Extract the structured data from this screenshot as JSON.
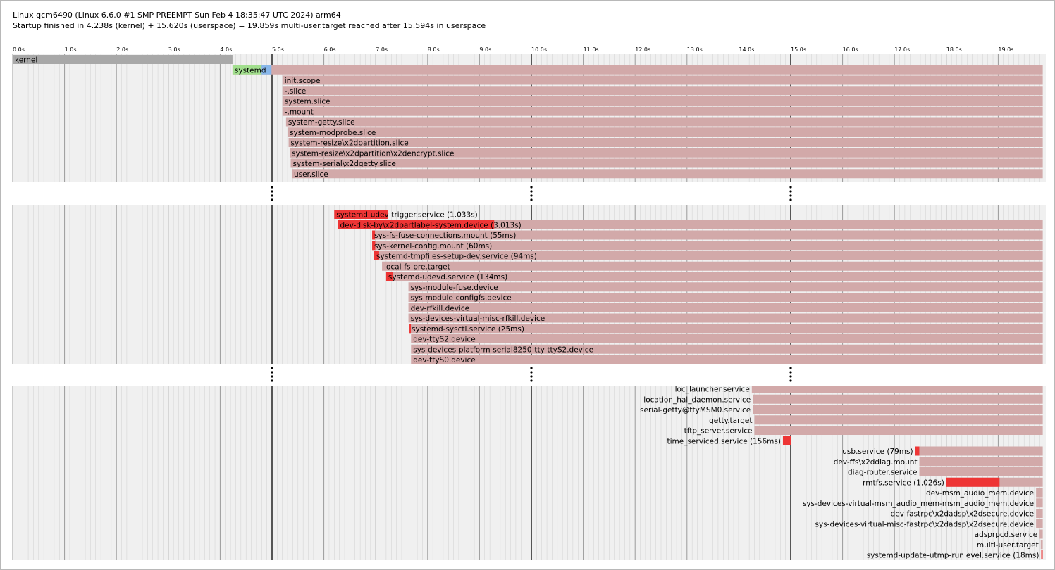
{
  "header": {
    "line1": "Linux qcm6490 (Linux 6.6.0 #1 SMP PREEMPT Sun Feb 4 18:35:47 UTC 2024) arm64",
    "line2": "Startup finished in 4.238s (kernel) + 15.620s (userspace) = 19.859s multi-user.target reached after 15.594s in userspace"
  },
  "colors": {
    "kernel": "#a8a8a8",
    "systemd": "#a2df8e",
    "systemd_tail": "#88b7ea",
    "active": "#d2a9a9",
    "activating": "#ee3535",
    "grid_bg": "#f0f0f0",
    "grid_minor": "#d0d0d0",
    "grid_major": "#505050"
  },
  "chart_data": {
    "type": "gantt",
    "x_unit": "s",
    "xlim": [
      0,
      19.9
    ],
    "ticks": [
      "0.0s",
      "1.0s",
      "2.0s",
      "3.0s",
      "4.0s",
      "5.0s",
      "6.0s",
      "7.0s",
      "8.0s",
      "9.0s",
      "10.0s",
      "11.0s",
      "12.0s",
      "13.0s",
      "14.0s",
      "15.0s",
      "16.0s",
      "17.0s",
      "18.0s",
      "19.0s"
    ],
    "sections": [
      {
        "rows": [
          {
            "label": "kernel",
            "start": 0.0,
            "end": 4.238,
            "kind": "kernel",
            "label_side": "inside"
          },
          {
            "label": "systemd",
            "start": 4.238,
            "end": 19.859,
            "kind": "systemd",
            "activating_end": 4.99,
            "label_side": "left"
          },
          {
            "label": "init.scope",
            "start": 5.2,
            "end": 19.859,
            "kind": "unit",
            "label_side": "inside"
          },
          {
            "label": "-.slice",
            "start": 5.2,
            "end": 19.859,
            "kind": "unit",
            "label_side": "inside"
          },
          {
            "label": "system.slice",
            "start": 5.2,
            "end": 19.859,
            "kind": "unit",
            "label_side": "inside"
          },
          {
            "label": "-.mount",
            "start": 5.2,
            "end": 19.859,
            "kind": "unit",
            "label_side": "inside"
          },
          {
            "label": "system-getty.slice",
            "start": 5.27,
            "end": 19.859,
            "kind": "unit",
            "label_side": "inside"
          },
          {
            "label": "system-modprobe.slice",
            "start": 5.3,
            "end": 19.859,
            "kind": "unit",
            "label_side": "inside"
          },
          {
            "label": "system-resize\\x2dpartition.slice",
            "start": 5.32,
            "end": 19.859,
            "kind": "unit",
            "label_side": "inside"
          },
          {
            "label": "system-resize\\x2dpartition\\x2dencrypt.slice",
            "start": 5.34,
            "end": 19.859,
            "kind": "unit",
            "label_side": "inside"
          },
          {
            "label": "system-serial\\x2dgetty.slice",
            "start": 5.36,
            "end": 19.859,
            "kind": "unit",
            "label_side": "inside"
          },
          {
            "label": "user.slice",
            "start": 5.38,
            "end": 19.859,
            "kind": "unit",
            "label_side": "inside"
          }
        ]
      },
      {
        "rows": [
          {
            "label": "systemd-udev-trigger.service (1.033s)",
            "start": 6.2,
            "end": 7.233,
            "kind": "unit",
            "activating_end": 7.233,
            "label_side": "inside"
          },
          {
            "label": "dev-disk-by\\x2dpartlabel-system.device (3.013s)",
            "start": 6.27,
            "end": 19.859,
            "kind": "unit",
            "activating_end": 9.283,
            "label_side": "inside"
          },
          {
            "label": "sys-fs-fuse-connections.mount (55ms)",
            "start": 6.93,
            "end": 19.859,
            "kind": "unit",
            "activating_end": 6.985,
            "label_side": "inside"
          },
          {
            "label": "sys-kernel-config.mount (60ms)",
            "start": 6.93,
            "end": 19.859,
            "kind": "unit",
            "activating_end": 6.99,
            "label_side": "inside"
          },
          {
            "label": "systemd-tmpfiles-setup-dev.service (94ms)",
            "start": 6.97,
            "end": 19.859,
            "kind": "unit",
            "activating_end": 7.064,
            "label_side": "inside"
          },
          {
            "label": "local-fs-pre.target",
            "start": 7.12,
            "end": 19.859,
            "kind": "unit",
            "label_side": "inside"
          },
          {
            "label": "systemd-udevd.service (134ms)",
            "start": 7.2,
            "end": 19.859,
            "kind": "unit",
            "activating_end": 7.334,
            "label_side": "inside"
          },
          {
            "label": "sys-module-fuse.device",
            "start": 7.63,
            "end": 19.859,
            "kind": "unit",
            "label_side": "inside"
          },
          {
            "label": "sys-module-configfs.device",
            "start": 7.63,
            "end": 19.859,
            "kind": "unit",
            "label_side": "inside"
          },
          {
            "label": "dev-rfkill.device",
            "start": 7.63,
            "end": 19.859,
            "kind": "unit",
            "label_side": "inside"
          },
          {
            "label": "sys-devices-virtual-misc-rfkill.device",
            "start": 7.63,
            "end": 19.859,
            "kind": "unit",
            "label_side": "inside"
          },
          {
            "label": "systemd-sysctl.service (25ms)",
            "start": 7.65,
            "end": 19.859,
            "kind": "unit",
            "activating_end": 7.675,
            "label_side": "inside"
          },
          {
            "label": "dev-ttyS2.device",
            "start": 7.68,
            "end": 19.859,
            "kind": "unit",
            "label_side": "inside"
          },
          {
            "label": "sys-devices-platform-serial8250-tty-ttyS2.device",
            "start": 7.68,
            "end": 19.859,
            "kind": "unit",
            "label_side": "inside"
          },
          {
            "label": "dev-ttyS0.device",
            "start": 7.68,
            "end": 19.859,
            "kind": "unit",
            "label_side": "inside"
          }
        ]
      },
      {
        "rows": [
          {
            "label": "loc_launcher.service",
            "start": 14.25,
            "end": 19.859,
            "kind": "unit",
            "label_side": "left"
          },
          {
            "label": "location_hal_daemon.service",
            "start": 14.27,
            "end": 19.859,
            "kind": "unit",
            "label_side": "left"
          },
          {
            "label": "serial-getty@ttyMSM0.service",
            "start": 14.27,
            "end": 19.859,
            "kind": "unit",
            "label_side": "left"
          },
          {
            "label": "getty.target",
            "start": 14.3,
            "end": 19.859,
            "kind": "unit",
            "label_side": "left"
          },
          {
            "label": "tftp_server.service",
            "start": 14.3,
            "end": 19.859,
            "kind": "unit",
            "label_side": "left"
          },
          {
            "label": "time_serviced.service (156ms)",
            "start": 14.85,
            "end": 15.006,
            "kind": "unit",
            "activating_end": 15.006,
            "label_side": "left"
          },
          {
            "label": "usb.service (79ms)",
            "start": 17.4,
            "end": 19.859,
            "kind": "unit",
            "activating_end": 17.479,
            "label_side": "left"
          },
          {
            "label": "dev-ffs\\x2ddiag.mount",
            "start": 17.48,
            "end": 19.859,
            "kind": "unit",
            "label_side": "left"
          },
          {
            "label": "diag-router.service",
            "start": 17.48,
            "end": 19.859,
            "kind": "unit",
            "label_side": "left"
          },
          {
            "label": "rmtfs.service (1.026s)",
            "start": 18.0,
            "end": 19.859,
            "kind": "unit",
            "activating_end": 19.026,
            "label_side": "left"
          },
          {
            "label": "dev-msm_audio_mem.device",
            "start": 19.73,
            "end": 19.859,
            "kind": "unit",
            "label_side": "left"
          },
          {
            "label": "sys-devices-virtual-msm_audio_mem-msm_audio_mem.device",
            "start": 19.73,
            "end": 19.859,
            "kind": "unit",
            "label_side": "left"
          },
          {
            "label": "dev-fastrpc\\x2dadsp\\x2dsecure.device",
            "start": 19.73,
            "end": 19.859,
            "kind": "unit",
            "label_side": "left"
          },
          {
            "label": "sys-devices-virtual-misc-fastrpc\\x2dadsp\\x2dsecure.device",
            "start": 19.73,
            "end": 19.859,
            "kind": "unit",
            "label_side": "left"
          },
          {
            "label": "adsprpcd.service",
            "start": 19.8,
            "end": 19.859,
            "kind": "unit",
            "label_side": "left"
          },
          {
            "label": "multi-user.target",
            "start": 19.82,
            "end": 19.859,
            "kind": "unit",
            "label_side": "left"
          },
          {
            "label": "systemd-update-utmp-runlevel.service (18ms)",
            "start": 19.83,
            "end": 19.859,
            "kind": "unit",
            "activating_end": 19.848,
            "label_side": "left"
          }
        ]
      }
    ]
  }
}
